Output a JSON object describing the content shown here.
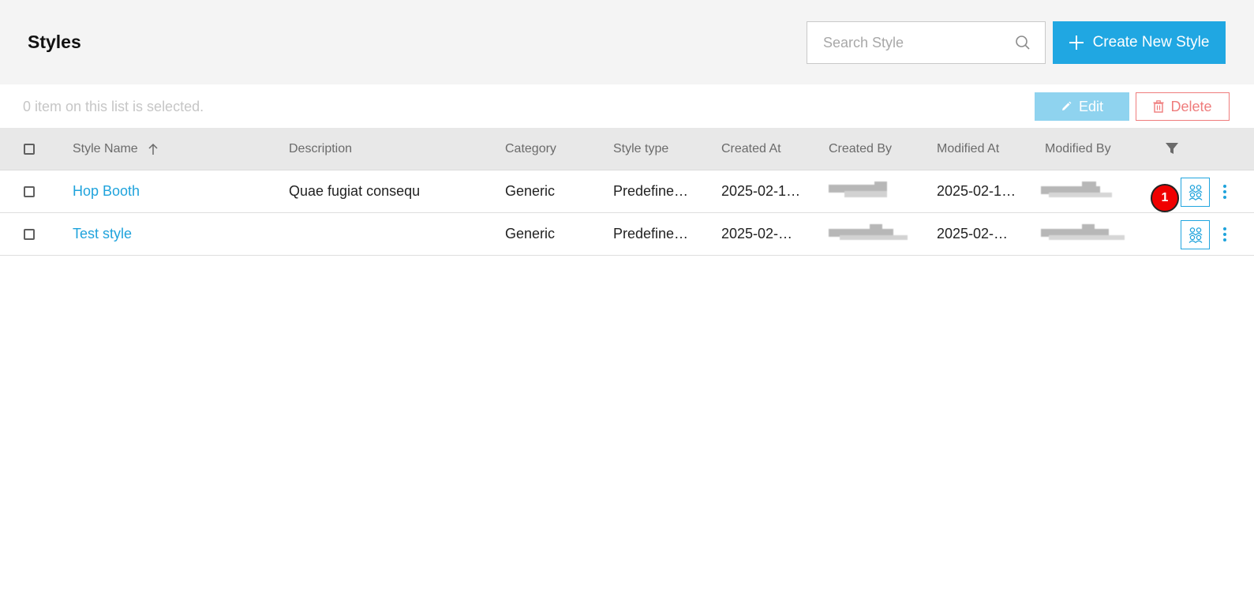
{
  "page": {
    "title": "Styles"
  },
  "search": {
    "placeholder": "Search Style"
  },
  "actions": {
    "create_label": "Create New Style",
    "edit_label": "Edit",
    "delete_label": "Delete"
  },
  "selection": {
    "text": "0 item on this list is selected."
  },
  "table": {
    "columns": [
      "Style Name",
      "Description",
      "Category",
      "Style type",
      "Created At",
      "Created By",
      "Modified At",
      "Modified By"
    ],
    "sort": {
      "column": "Style Name",
      "direction": "ascending"
    },
    "rows": [
      {
        "name": "Hop Booth",
        "description": "Quae fugiat consequ",
        "category": "Generic",
        "style_type": "Predefine…",
        "created_at": "2025-02-1…",
        "modified_at": "2025-02-1…"
      },
      {
        "name": "Test style",
        "description": "",
        "category": "Generic",
        "style_type": "Predefine…",
        "created_at": "2025-02-…",
        "modified_at": "2025-02-…"
      }
    ]
  },
  "badge": {
    "label": "1",
    "color": "#f00000"
  },
  "colors": {
    "accent": "#20a7e2",
    "link": "#1fa3dc",
    "danger": "#ef7c7c",
    "header_bg": "#f4f4f4"
  }
}
